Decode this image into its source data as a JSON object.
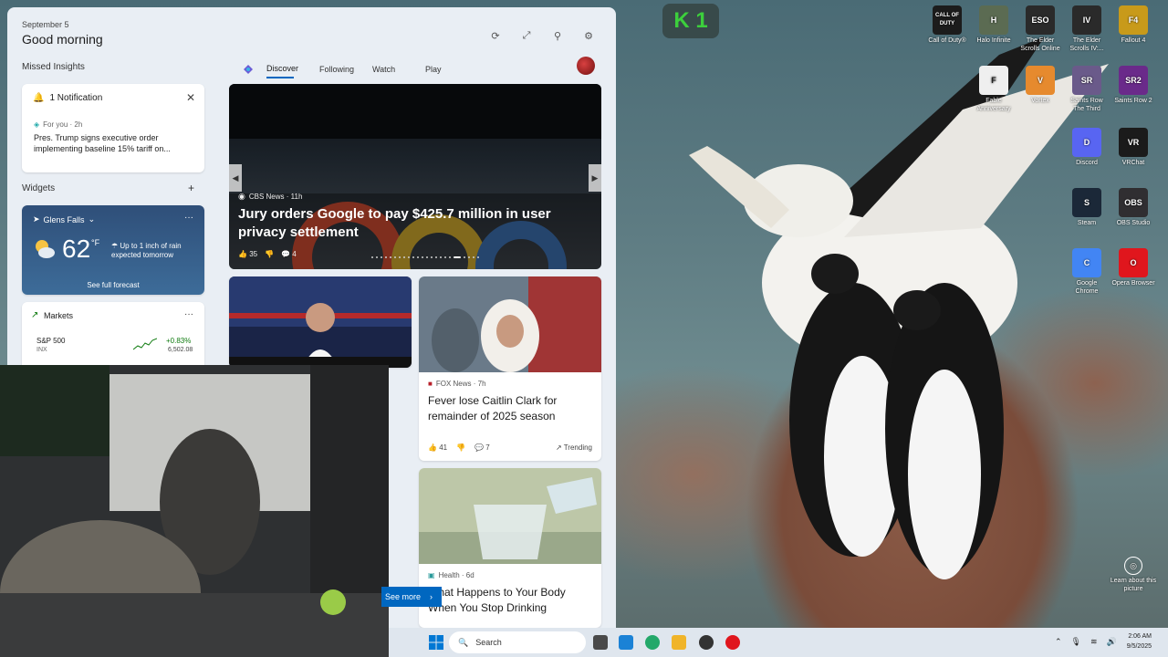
{
  "panel": {
    "date": "September 5",
    "greeting": "Good morning",
    "missed_insights": "Missed Insights",
    "widgets_label": "Widgets",
    "widgets_add": "+"
  },
  "notification": {
    "title": "1 Notification",
    "source": "For you · 2h",
    "text": "Pres. Trump signs executive order implementing baseline 15% tariff on..."
  },
  "weather": {
    "location": "Glens Falls",
    "temp": "62",
    "unit": "°F",
    "note": "Up to 1 inch of rain expected tomorrow",
    "forecast_link": "See full forecast",
    "more": "···"
  },
  "markets": {
    "title": "Markets",
    "more": "···",
    "name": "S&P 500",
    "sub": "INX",
    "change": "+0.83%",
    "value": "6,502.08"
  },
  "feed": {
    "tabs": [
      "Discover",
      "Following",
      "Watch",
      "Play"
    ]
  },
  "hero": {
    "source": "CBS News · 11h",
    "title": "Jury orders Google to pay $425.7 million in user privacy settlement",
    "likes": "35",
    "comments": "4"
  },
  "news2": {
    "source": "FOX News · 7h",
    "title": "Fever lose Caitlin Clark for remainder of 2025 season",
    "likes": "41",
    "comments": "7",
    "trending": "Trending"
  },
  "news3": {
    "source": "Health · 6d",
    "title": "What Happens to Your Body When You Stop Drinking"
  },
  "see_more": "See more",
  "desktop_icons": [
    {
      "label": "Call of Duty®",
      "badge": "CALL OF DUTY",
      "color": "#1c1c1c"
    },
    {
      "label": "Halo Infinite",
      "badge": "H",
      "color": "#5b6b52"
    },
    {
      "label": "The Elder Scrolls Online",
      "badge": "ESO",
      "color": "#2a2a2a"
    },
    {
      "label": "The Elder Scrolls IV:...",
      "badge": "IV",
      "color": "#2a2a2a"
    },
    {
      "label": "Fallout 4",
      "badge": "F4",
      "color": "#c89a1a"
    },
    {
      "label": "Fable Anniversary",
      "badge": "F",
      "color": "#efefef"
    },
    {
      "label": "Vortex",
      "badge": "V",
      "color": "#e68a2e"
    },
    {
      "label": "Saints Row The Third",
      "badge": "SR",
      "color": "#6a5a8a"
    },
    {
      "label": "Saints Row 2",
      "badge": "SR2",
      "color": "#6a2a8a"
    },
    {
      "label": "Discord",
      "badge": "D",
      "color": "#5865f2"
    },
    {
      "label": "VRChat",
      "badge": "VR",
      "color": "#1b1b1b"
    },
    {
      "label": "Steam",
      "badge": "S",
      "color": "#1b2838"
    },
    {
      "label": "OBS Studio",
      "badge": "OBS",
      "color": "#302e31"
    },
    {
      "label": "Google Chrome",
      "badge": "C",
      "color": "#4285f4"
    },
    {
      "label": "Opera Browser",
      "badge": "O",
      "color": "#e0161d"
    }
  ],
  "learn_about": "Learn about this picture",
  "k1_label": "K 1",
  "taskbar": {
    "search_placeholder": "Search",
    "time": "2:06 AM",
    "date": "9/5/2025"
  },
  "colors": {
    "accent": "#0067c0",
    "panel_bg": "#e9eef4",
    "market_up": "#0f7b0f"
  }
}
